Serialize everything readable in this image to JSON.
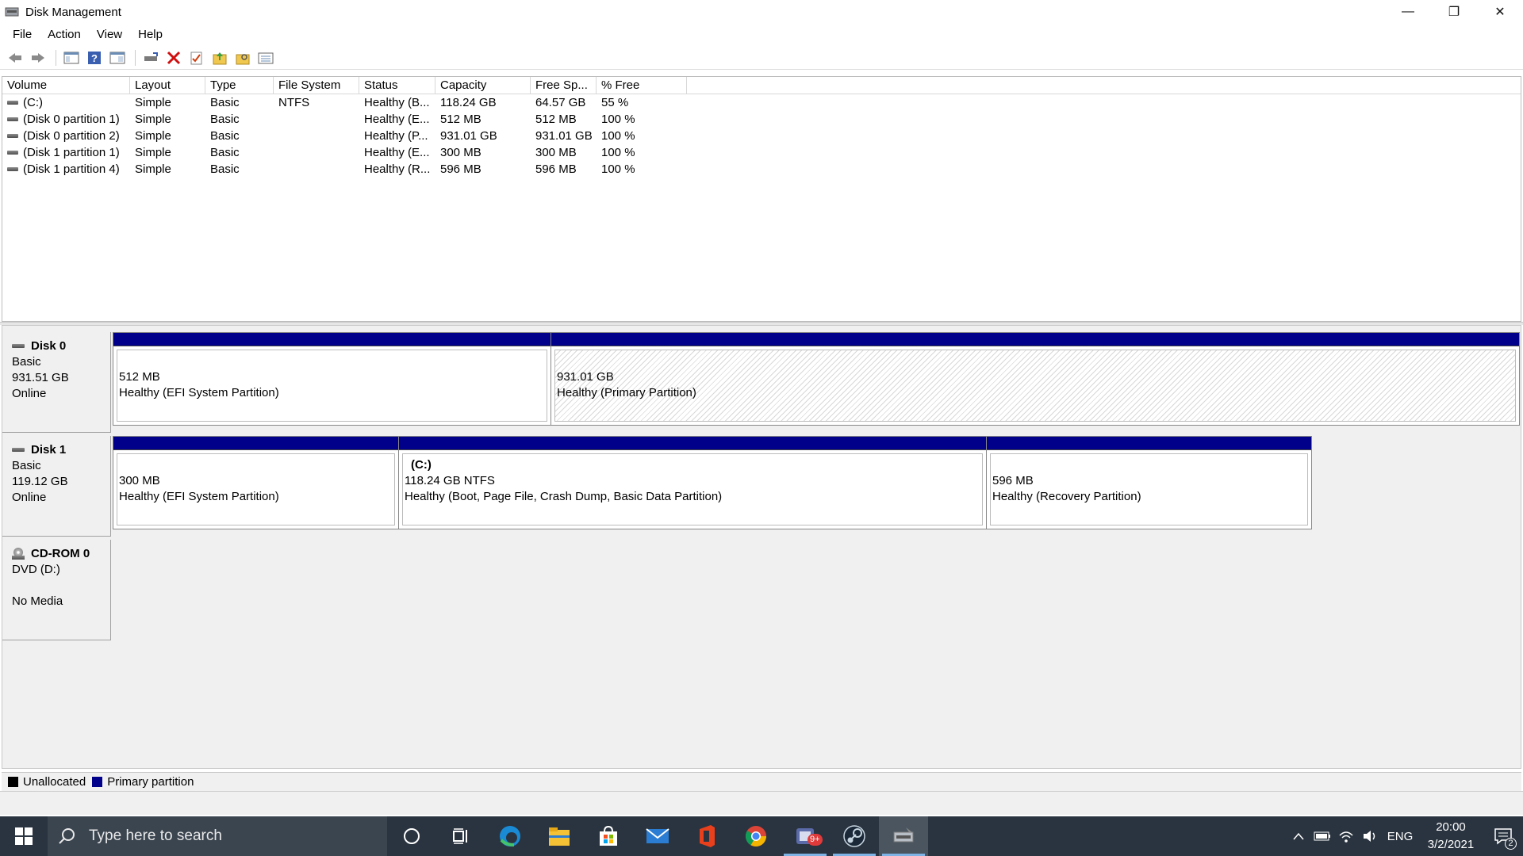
{
  "window": {
    "title": "Disk Management",
    "minimize_glyph": "—",
    "maximize_glyph": "❐",
    "close_glyph": "✕"
  },
  "menu": [
    "File",
    "Action",
    "View",
    "Help"
  ],
  "toolbar": {
    "icons": [
      "back-icon",
      "forward-icon",
      "show-hide-console-tree-icon",
      "help-icon",
      "properties-icon",
      "connect-drive-icon",
      "delete-icon",
      "check-icon",
      "up-folder-icon",
      "open-folder-icon",
      "view-icon"
    ]
  },
  "volume_list": {
    "columns": [
      "Volume",
      "Layout",
      "Type",
      "File System",
      "Status",
      "Capacity",
      "Free Sp...",
      "% Free"
    ],
    "rows": [
      {
        "volume": "(C:)",
        "layout": "Simple",
        "type": "Basic",
        "fs": "NTFS",
        "status": "Healthy (B...",
        "capacity": "118.24 GB",
        "free": "64.57 GB",
        "pct": "55 %"
      },
      {
        "volume": "(Disk 0 partition 1)",
        "layout": "Simple",
        "type": "Basic",
        "fs": "",
        "status": "Healthy (E...",
        "capacity": "512 MB",
        "free": "512 MB",
        "pct": "100 %"
      },
      {
        "volume": "(Disk 0 partition 2)",
        "layout": "Simple",
        "type": "Basic",
        "fs": "",
        "status": "Healthy (P...",
        "capacity": "931.01 GB",
        "free": "931.01 GB",
        "pct": "100 %"
      },
      {
        "volume": "(Disk 1 partition 1)",
        "layout": "Simple",
        "type": "Basic",
        "fs": "",
        "status": "Healthy (E...",
        "capacity": "300 MB",
        "free": "300 MB",
        "pct": "100 %"
      },
      {
        "volume": "(Disk 1 partition 4)",
        "layout": "Simple",
        "type": "Basic",
        "fs": "",
        "status": "Healthy (R...",
        "capacity": "596 MB",
        "free": "596 MB",
        "pct": "100 %"
      }
    ]
  },
  "disks": {
    "disk0": {
      "name": "Disk 0",
      "type": "Basic",
      "size": "931.51 GB",
      "state": "Online",
      "p1": {
        "size": "512 MB",
        "status": "Healthy (EFI System Partition)"
      },
      "p2": {
        "size": "931.01 GB",
        "status": "Healthy (Primary Partition)"
      }
    },
    "disk1": {
      "name": "Disk 1",
      "type": "Basic",
      "size": "119.12 GB",
      "state": "Online",
      "p1": {
        "size": "300 MB",
        "status": "Healthy (EFI System Partition)"
      },
      "p2": {
        "name": "(C:)",
        "size": "118.24 GB NTFS",
        "status": "Healthy (Boot, Page File, Crash Dump, Basic Data Partition)"
      },
      "p3": {
        "size": "596 MB",
        "status": "Healthy (Recovery Partition)"
      }
    },
    "cdrom0": {
      "name": "CD-ROM 0",
      "type": "DVD (D:)",
      "state": "No Media"
    }
  },
  "legend": {
    "unallocated": "Unallocated",
    "primary": "Primary partition",
    "unallocated_color": "#000000",
    "primary_color": "#00008b"
  },
  "taskbar": {
    "search_placeholder": "Type here to search",
    "apps": [
      "cortana-icon",
      "task-view-icon",
      "edge-icon",
      "file-explorer-icon",
      "store-icon",
      "mail-icon",
      "office-icon",
      "chrome-icon",
      "notifications-app-icon",
      "steam-icon",
      "disk-management-icon"
    ],
    "badge": "9+",
    "language": "ENG",
    "time": "20:00",
    "date": "3/2/2021",
    "notification_count": "2"
  }
}
